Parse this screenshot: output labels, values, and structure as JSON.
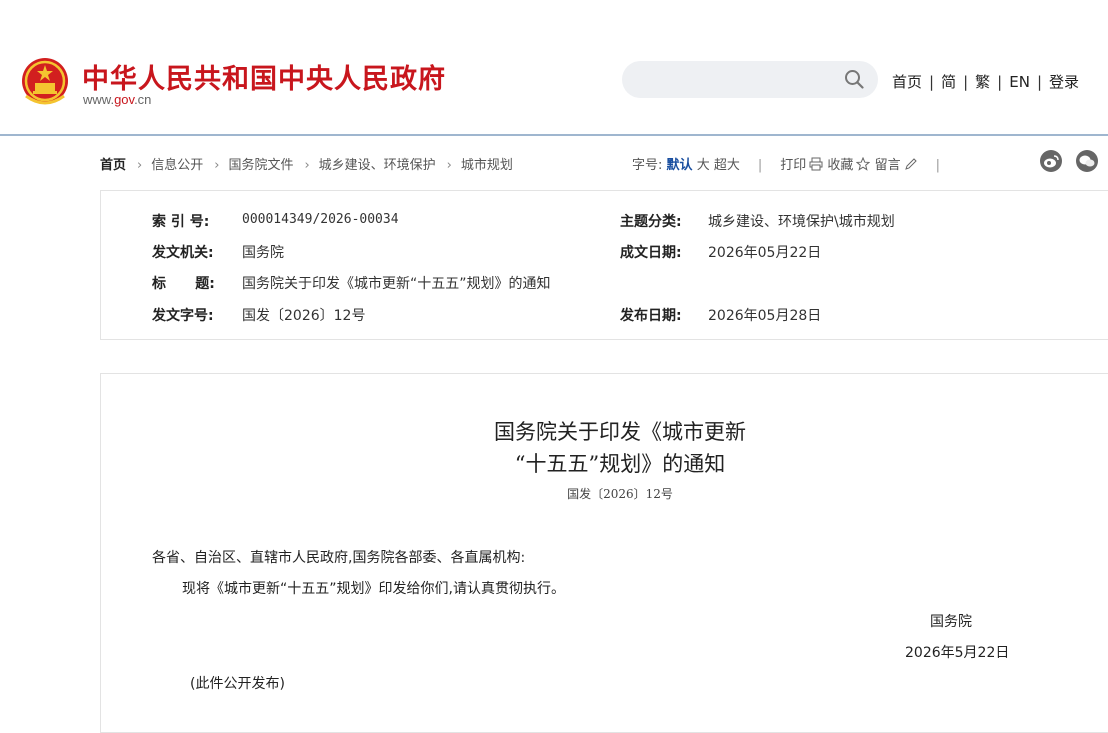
{
  "header": {
    "title": "中华人民共和国中央人民政府",
    "url_prefix": "www.",
    "url_domain": "gov",
    "url_suffix": ".cn",
    "search_placeholder": "",
    "nav": [
      "首页",
      "简",
      "繁",
      "EN",
      "登录"
    ],
    "nav_sep": "|"
  },
  "breadcrumb": {
    "items": [
      "首页",
      "信息公开",
      "国务院文件",
      "城乡建设、环境保护",
      "城市规划"
    ],
    "arrow": "›"
  },
  "toolbar": {
    "font_label": "字号:",
    "font_default": "默认",
    "font_large": "大",
    "font_xlarge": "超大",
    "sep": "|",
    "print": "打印",
    "favorite": "收藏",
    "comment": "留言"
  },
  "meta": {
    "index_label": "索 引 号:",
    "index_value": "000014349/2026-00034",
    "category_label": "主题分类:",
    "category_value": "城乡建设、环境保护\\城市规划",
    "issuer_label": "发文机关:",
    "issuer_value": "国务院",
    "written_label": "成文日期:",
    "written_value": "2026年05月22日",
    "title_label": "标      题:",
    "title_value": "国务院关于印发《城市更新“十五五”规划》的通知",
    "docno_label": "发文字号:",
    "docno_value": "国发〔2026〕12号",
    "published_label": "发布日期:",
    "published_value": "2026年05月28日"
  },
  "document": {
    "title_line1": "国务院关于印发《城市更新",
    "title_line2": "“十五五”规划》的通知",
    "doc_number": "国发〔2026〕12号",
    "salutation": "各省、自治区、直辖市人民政府,国务院各部委、各直属机构:",
    "body": "现将《城市更新“十五五”规划》印发给你们,请认真贯彻执行。",
    "signer": "国务院",
    "date": "2026年5月22日",
    "note": "(此件公开发布)"
  },
  "colors": {
    "brand_red": "#c8161d",
    "active_blue": "#1a4fa0",
    "header_line": "#9fb6cf"
  },
  "icons": [
    "national-emblem-icon",
    "search-icon",
    "print-icon",
    "star-icon",
    "pencil-icon",
    "weibo-icon",
    "wechat-icon"
  ]
}
